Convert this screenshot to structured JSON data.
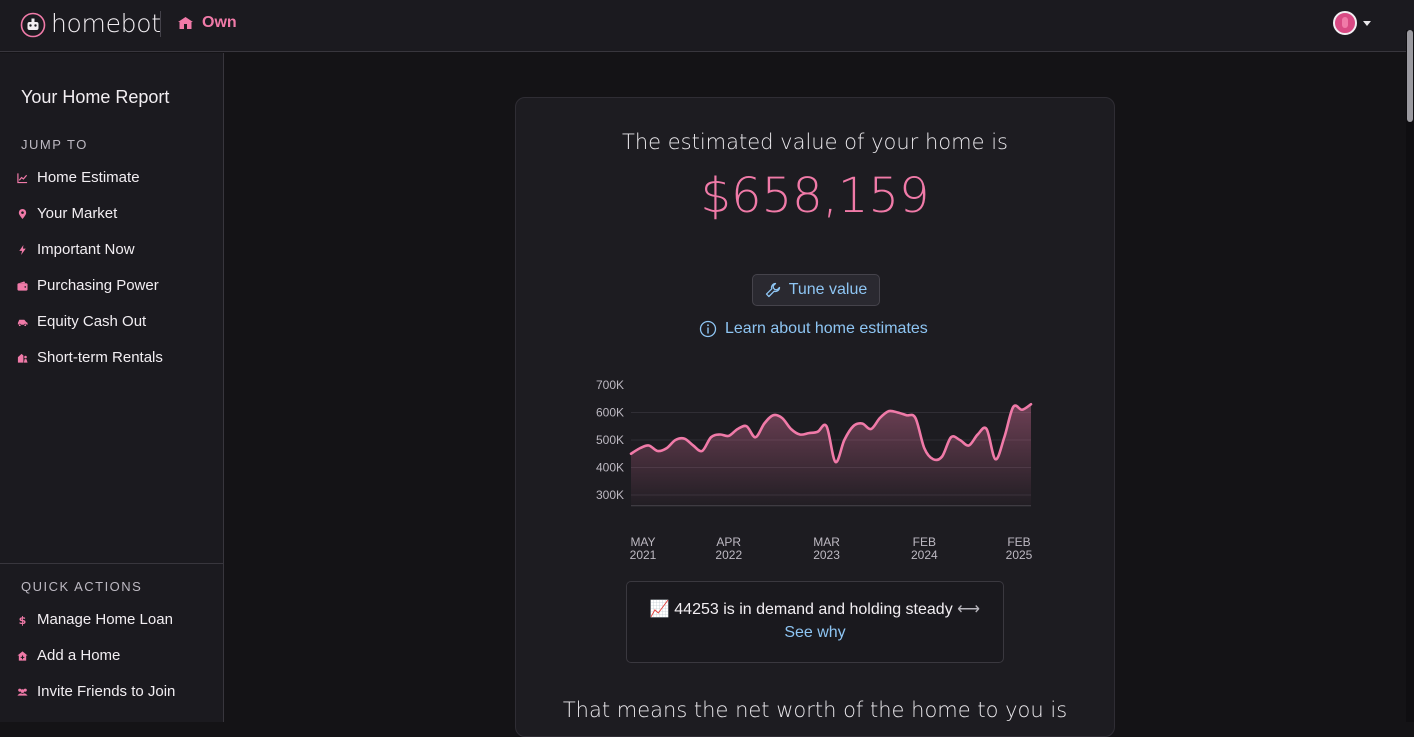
{
  "app": {
    "logo_text": "homebot"
  },
  "topbar": {
    "own_label": "Own"
  },
  "sidebar": {
    "title": "Your Home Report",
    "jump_to_label": "JUMP TO",
    "items": [
      {
        "label": "Home Estimate",
        "icon": "chart-line-icon"
      },
      {
        "label": "Your Market",
        "icon": "map-pin-icon"
      },
      {
        "label": "Important Now",
        "icon": "bolt-icon"
      },
      {
        "label": "Purchasing Power",
        "icon": "wallet-icon"
      },
      {
        "label": "Equity Cash Out",
        "icon": "car-icon"
      },
      {
        "label": "Short-term Rentals",
        "icon": "house-person-icon"
      }
    ],
    "quick_actions_label": "QUICK ACTIONS",
    "quick_actions": [
      {
        "label": "Manage Home Loan",
        "icon": "dollar-icon"
      },
      {
        "label": "Add a Home",
        "icon": "home-plus-icon"
      },
      {
        "label": "Invite Friends to Join",
        "icon": "users-icon"
      }
    ]
  },
  "card": {
    "headline": "The estimated value of your home is",
    "value": "$658,159",
    "tune_label": "Tune value",
    "learn_label": "Learn about home estimates",
    "demand_emoji": "📈",
    "demand_text": "44253 is in demand and holding steady",
    "demand_arrow": "⟷",
    "see_why_label": "See why",
    "net_worth_text": "That means the net worth of the home to you is"
  },
  "colors": {
    "accent": "#f07aa8",
    "link": "#8ec5f3",
    "background": "#141316",
    "panel": "#1d1c21"
  },
  "chart_data": {
    "type": "area",
    "y_ticks": [
      "700K",
      "600K",
      "500K",
      "400K",
      "300K"
    ],
    "ylim": [
      250000,
      700000
    ],
    "x_ticks": [
      {
        "month": "MAY",
        "year": "2021"
      },
      {
        "month": "APR",
        "year": "2022"
      },
      {
        "month": "MAR",
        "year": "2023"
      },
      {
        "month": "FEB",
        "year": "2024"
      },
      {
        "month": "FEB",
        "year": "2025"
      }
    ],
    "x": [
      "2021-05",
      "2021-06",
      "2021-07",
      "2021-08",
      "2021-09",
      "2021-10",
      "2021-11",
      "2021-12",
      "2022-01",
      "2022-02",
      "2022-03",
      "2022-04",
      "2022-05",
      "2022-06",
      "2022-07",
      "2022-08",
      "2022-09",
      "2022-10",
      "2022-11",
      "2022-12",
      "2023-01",
      "2023-02",
      "2023-03",
      "2023-04",
      "2023-05",
      "2023-06",
      "2023-07",
      "2023-08",
      "2023-09",
      "2023-10",
      "2023-11",
      "2023-12",
      "2024-01",
      "2024-02",
      "2024-03",
      "2024-04",
      "2024-05",
      "2024-06",
      "2024-07",
      "2024-08",
      "2024-09",
      "2024-10",
      "2024-11",
      "2024-12",
      "2025-01",
      "2025-02"
    ],
    "series": [
      {
        "values": [
          450000,
          470000,
          480000,
          460000,
          470000,
          500000,
          505000,
          480000,
          460000,
          510000,
          520000,
          515000,
          540000,
          550000,
          510000,
          560000,
          590000,
          580000,
          540000,
          520000,
          525000,
          530000,
          550000,
          420000,
          500000,
          550000,
          560000,
          540000,
          580000,
          605000,
          600000,
          590000,
          580000,
          470000,
          430000,
          440000,
          510000,
          500000,
          480000,
          520000,
          540000,
          430000,
          510000,
          620000,
          610000,
          630000
        ]
      }
    ],
    "grid": true
  }
}
